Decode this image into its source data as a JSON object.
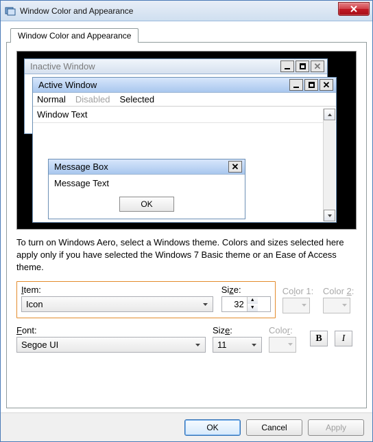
{
  "window": {
    "title": "Window Color and Appearance",
    "tab_label": "Window Color and Appearance"
  },
  "preview": {
    "inactive_title": "Inactive Window",
    "active_title": "Active Window",
    "menu": {
      "normal": "Normal",
      "disabled": "Disabled",
      "selected": "Selected"
    },
    "window_text": "Window Text",
    "msgbox_title": "Message Box",
    "msgbox_text": "Message Text",
    "ok": "OK"
  },
  "description": "To turn on Windows Aero, select a Windows theme.  Colors and sizes selected here apply only if you have selected the Windows 7 Basic theme or an Ease of Access theme.",
  "item": {
    "label": "Item:",
    "value": "Icon",
    "size_label": "Size:",
    "size_value": "32",
    "color1_label": "Color 1:",
    "color2_label": "Color 2:"
  },
  "font": {
    "label": "Font:",
    "value": "Segoe UI",
    "size_label": "Size:",
    "size_value": "11",
    "color_label": "Color:",
    "bold": "B",
    "italic": "I"
  },
  "footer": {
    "ok": "OK",
    "cancel": "Cancel",
    "apply": "Apply"
  }
}
